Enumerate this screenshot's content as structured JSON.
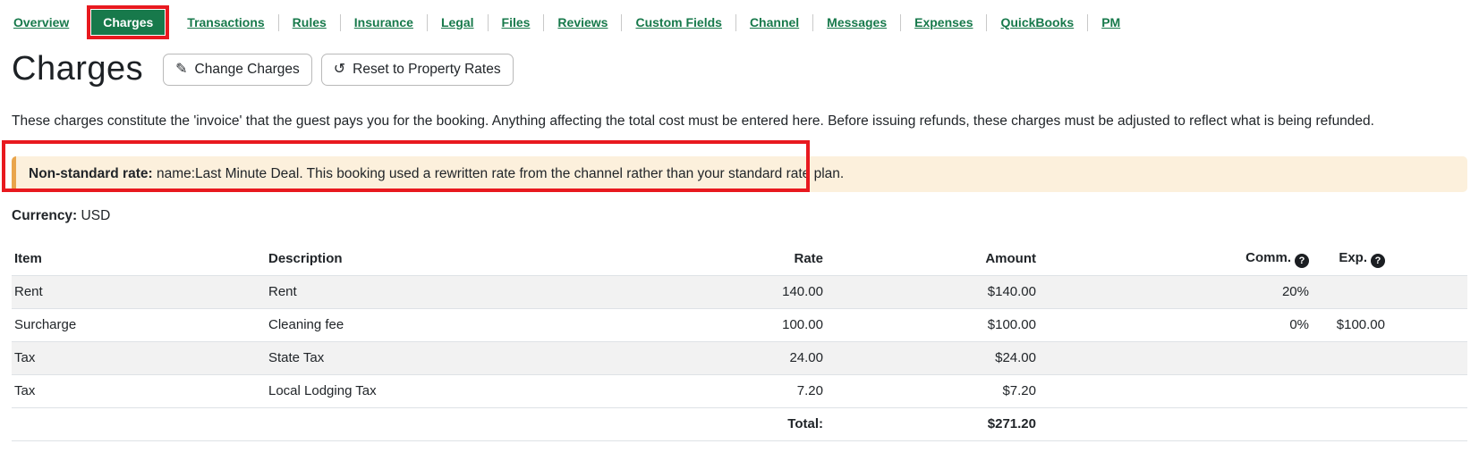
{
  "colors": {
    "accent_green": "#17794B",
    "annotation_red": "#E8191F",
    "alert_bg": "#FCF0DC",
    "alert_accent": "#E9A54C",
    "stripe_gray": "#F2F2F2",
    "border_gray": "#DEE2E6",
    "text_dark": "#212529",
    "button_border": "#B9B9B9"
  },
  "icons": {
    "pencil": "✎",
    "undo": "↺",
    "help": "?"
  },
  "nav": {
    "items": [
      {
        "label": "Overview",
        "active": false
      },
      {
        "label": "Charges",
        "active": true
      },
      {
        "label": "Transactions",
        "active": false
      },
      {
        "label": "Rules",
        "active": false
      },
      {
        "label": "Insurance",
        "active": false
      },
      {
        "label": "Legal",
        "active": false
      },
      {
        "label": "Files",
        "active": false
      },
      {
        "label": "Reviews",
        "active": false
      },
      {
        "label": "Custom Fields",
        "active": false
      },
      {
        "label": "Channel",
        "active": false
      },
      {
        "label": "Messages",
        "active": false
      },
      {
        "label": "Expenses",
        "active": false
      },
      {
        "label": "QuickBooks",
        "active": false
      },
      {
        "label": "PM",
        "active": false
      }
    ]
  },
  "header": {
    "title": "Charges",
    "buttons": [
      {
        "icon": "pencil-icon",
        "label": "Change Charges"
      },
      {
        "icon": "undo-icon",
        "label": "Reset to Property Rates"
      }
    ]
  },
  "intro": {
    "text": "These charges constitute the 'invoice' that the guest pays you for the booking. Anything affecting the total cost must be entered here. Before issuing refunds, these charges must be adjusted to reflect what is being refunded."
  },
  "alert": {
    "bold_label": "Non-standard rate:",
    "text": " name:Last Minute Deal. This booking used a rewritten rate from the channel rather than your standard rate plan."
  },
  "currency": {
    "label": "Currency:",
    "value": "USD"
  },
  "table": {
    "columns": [
      {
        "label": "Item"
      },
      {
        "label": "Description"
      },
      {
        "label": "Rate"
      },
      {
        "label": "Amount"
      },
      {
        "label": "Comm.",
        "help": true
      },
      {
        "label": "Exp.",
        "help": true
      }
    ],
    "rows": [
      {
        "item": "Rent",
        "description": "Rent",
        "rate": "140.00",
        "amount": "$140.00",
        "comm": "20%",
        "exp": ""
      },
      {
        "item": "Surcharge",
        "description": "Cleaning fee",
        "rate": "100.00",
        "amount": "$100.00",
        "comm": "0%",
        "exp": "$100.00"
      },
      {
        "item": "Tax",
        "description": "State Tax",
        "rate": "24.00",
        "amount": "$24.00",
        "comm": "",
        "exp": ""
      },
      {
        "item": "Tax",
        "description": "Local Lodging Tax",
        "rate": "7.20",
        "amount": "$7.20",
        "comm": "",
        "exp": ""
      }
    ],
    "total": {
      "label": "Total:",
      "value": "$271.20"
    }
  }
}
